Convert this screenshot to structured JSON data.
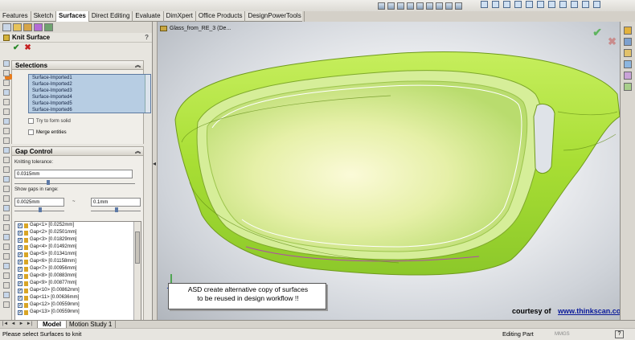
{
  "tabs": [
    "Features",
    "Sketch",
    "Surfaces",
    "Direct Editing",
    "Evaluate",
    "DimXpert",
    "Office Products",
    "DesignPowerTools"
  ],
  "active_tab": "Surfaces",
  "feature": {
    "title": "Knit Surface",
    "help_icon": "?",
    "ok_icon": "✔",
    "cancel_icon": "✖"
  },
  "selections": {
    "header": "Selections",
    "chevron": "︽",
    "items": [
      "Surface-Imported1",
      "Surface-Imported2",
      "Surface-Imported3",
      "Surface-Imported4",
      "Surface-Imported5",
      "Surface-Imported6"
    ],
    "try_to_form_solid": "Try to form solid",
    "merge_entities": "Merge entities"
  },
  "gap_control": {
    "header": "Gap Control",
    "chevron": "︽",
    "tolerance_label": "Knitting tolerance:",
    "tolerance_value": "0.0315mm",
    "range_label": "Show gaps in range:",
    "range_min": "0.0025mm",
    "range_sep": "~",
    "range_max": "0.1mm",
    "gaps": [
      "Gap<1> [0.0252mm]",
      "Gap<2> [0.02501mm]",
      "Gap<3> [0.01829mm]",
      "Gap<4> [0.01492mm]",
      "Gap<5> [0.01341mm]",
      "Gap<6> [0.01158mm]",
      "Gap<7> [0.00956mm]",
      "Gap<8> [0.00883mm]",
      "Gap<9> [0.00877mm]",
      "Gap<10> [0.00862mm]",
      "Gap<11> [0.00636mm]",
      "Gap<12> [0.00559mm]",
      "Gap<13> [0.00559mm]"
    ]
  },
  "viewport": {
    "tree_label": "Glass_from_RE_3  (De...",
    "ok_icon": "✔",
    "cancel_icon": "✖",
    "callout_line1": "ASD create alternative copy of surfaces",
    "callout_line2": "to be reused in design workflow !!",
    "credit": "courtesy of",
    "credit_url": "www.thinkscan.co.uk"
  },
  "bottom_tabs": {
    "model": "Model",
    "motion": "Motion Study 1",
    "nav": [
      "|◄",
      "◄",
      "►",
      "►|"
    ]
  },
  "status": {
    "message": "Please select Surfaces to knit",
    "mode": "Editing Part",
    "units": "MMGS",
    "help": "?"
  },
  "colors": {
    "surface_green": "#a9e23a",
    "selection_blue": "#b7cde3",
    "accent_orange": "#e77c1d"
  }
}
